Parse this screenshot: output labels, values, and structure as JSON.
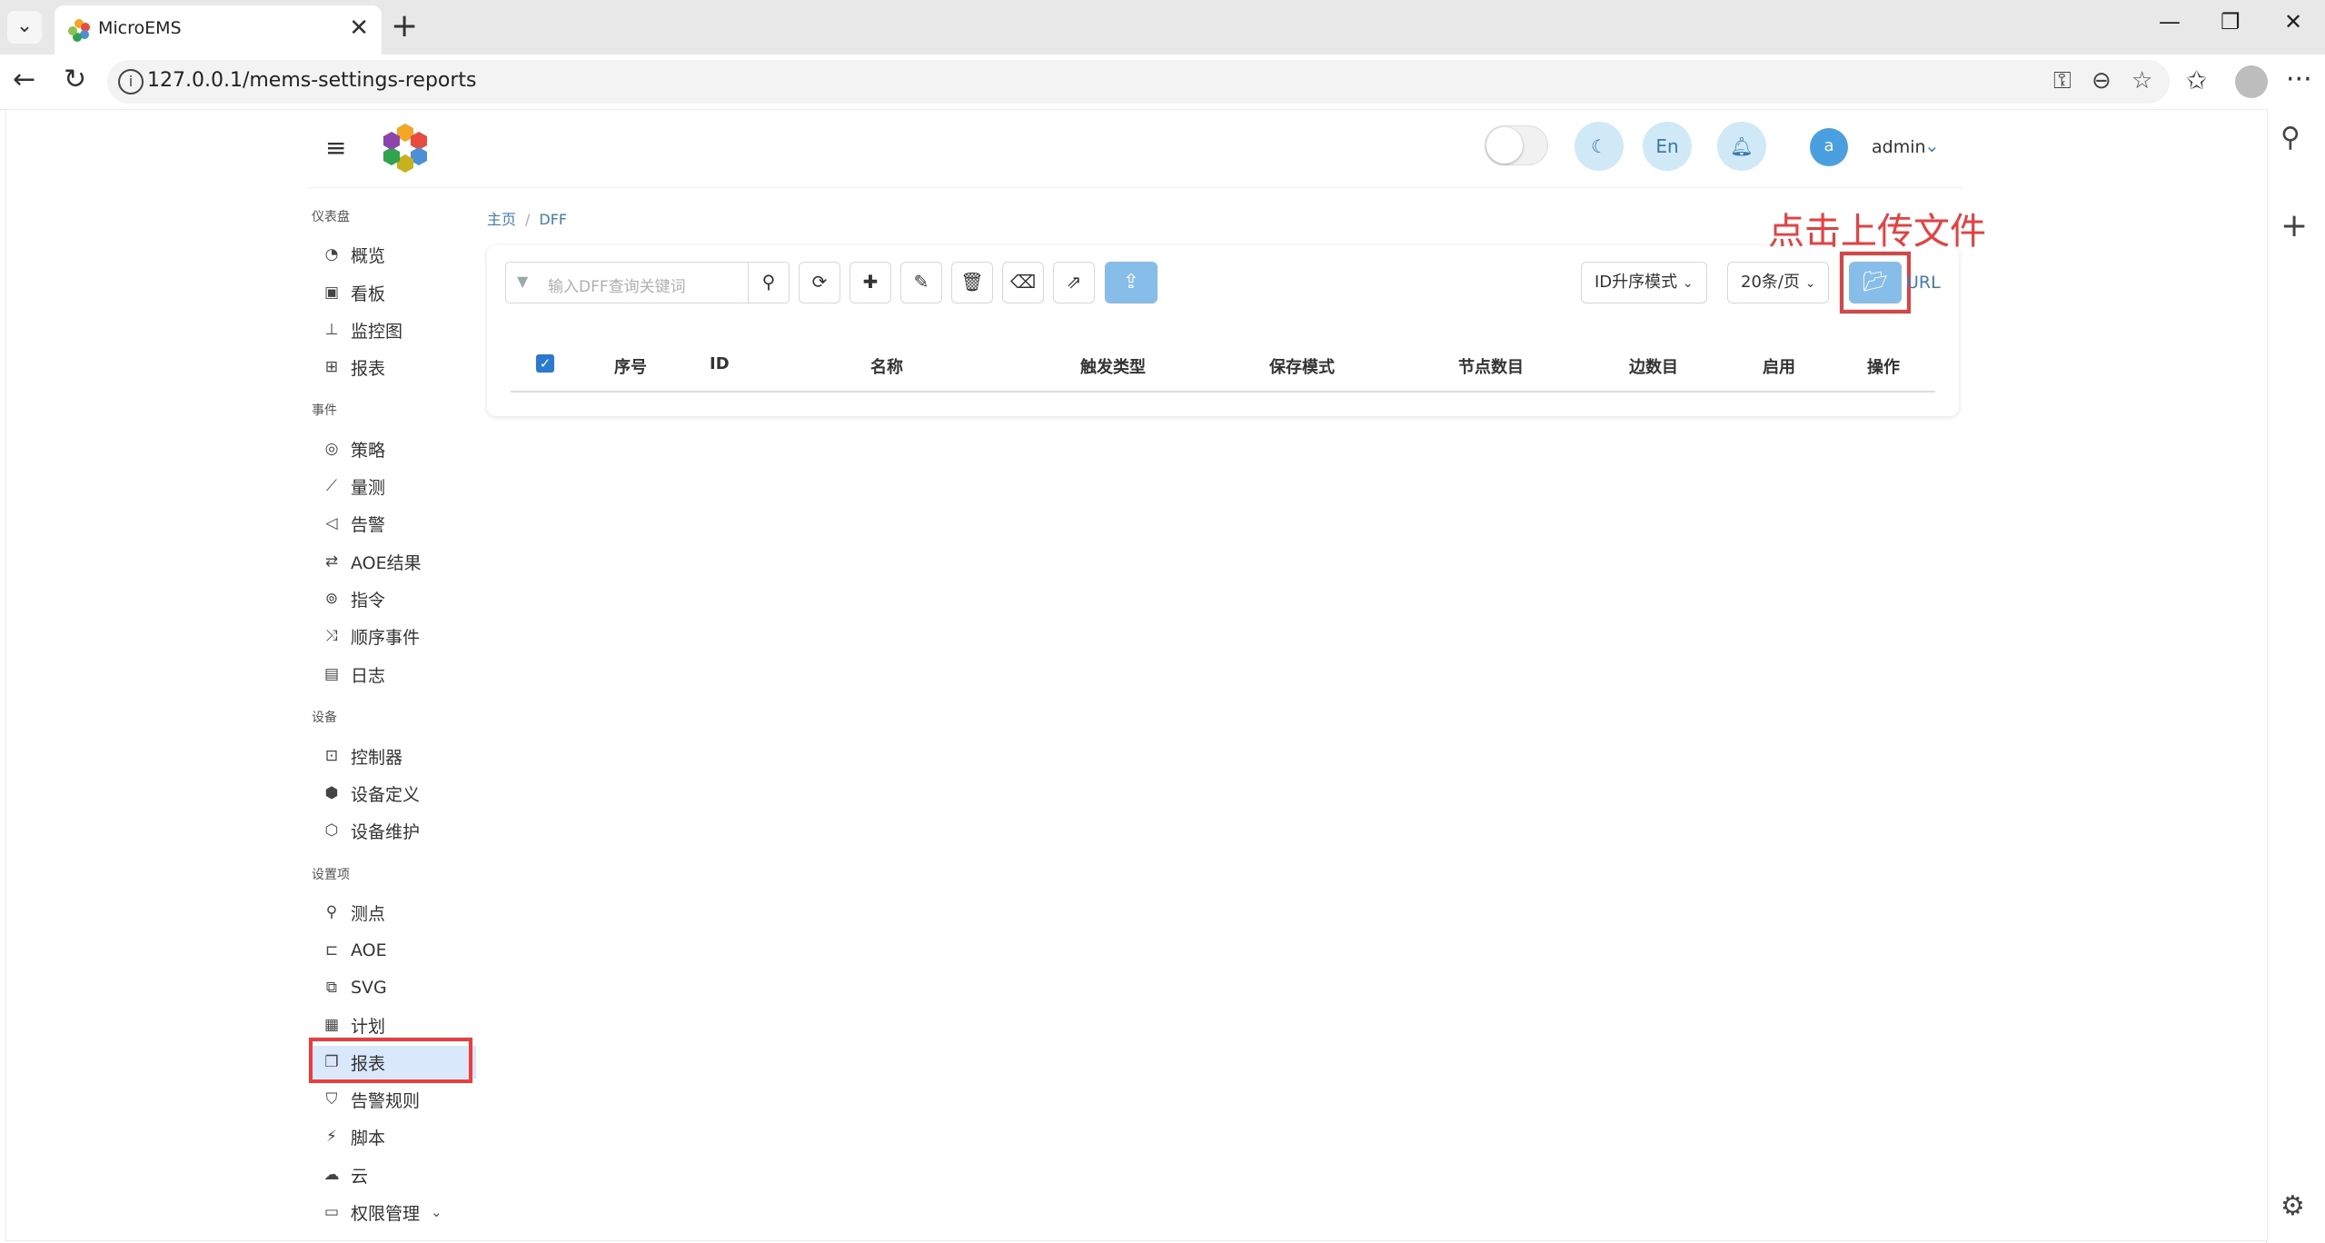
{
  "browser": {
    "tab_title": "MicroEMS",
    "tab_close": "✕",
    "new_tab": "+",
    "url": "127.0.0.1/mems-settings-reports",
    "window_controls": [
      "—",
      "❐",
      "✕"
    ]
  },
  "header": {
    "language_label": "En",
    "user_initial": "a",
    "user_name": "admin"
  },
  "nav": {
    "groups": [
      {
        "title": "仪表盘",
        "items": [
          "概览",
          "看板",
          "监控图",
          "报表"
        ]
      },
      {
        "title": "事件",
        "items": [
          "策略",
          "量测",
          "告警",
          "AOE结果",
          "指令",
          "顺序事件",
          "日志"
        ]
      },
      {
        "title": "设备",
        "items": [
          "控制器",
          "设备定义",
          "设备维护"
        ]
      },
      {
        "title": "设置项",
        "items": [
          "测点",
          "AOE",
          "SVG",
          "计划",
          "报表",
          "告警规则",
          "脚本",
          "云",
          "权限管理"
        ]
      }
    ],
    "active_item": "报表"
  },
  "breadcrumb": {
    "home": "主页",
    "separator": "/",
    "current": "DFF"
  },
  "toolbar": {
    "search_placeholder": "输入DFF查询关键词",
    "sort_select": "ID升序模式",
    "page_size_select": "20条/页",
    "url_link": "URL",
    "annotation": "点击上传文件"
  },
  "table": {
    "columns": [
      "序号",
      "ID",
      "名称",
      "触发类型",
      "保存模式",
      "节点数目",
      "边数目",
      "启用",
      "操作"
    ]
  },
  "colors": {
    "accent": "#3c7dc0",
    "upload_button": "#86bde9",
    "highlight": "#ee3b3b",
    "active_nav_bg": "#d9e8fb"
  }
}
